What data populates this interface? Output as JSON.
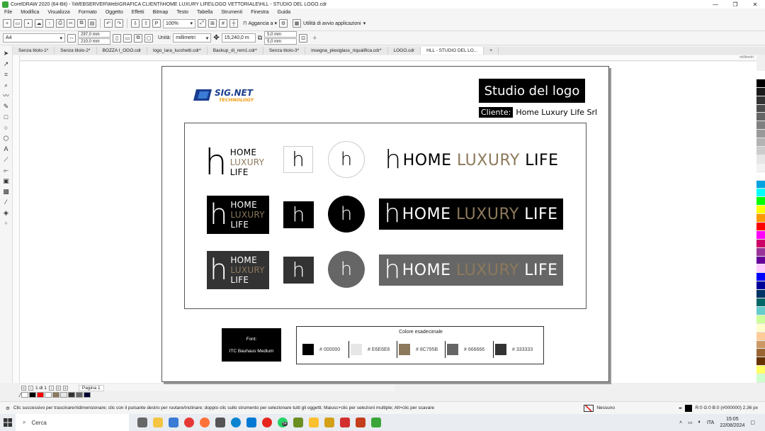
{
  "window": {
    "title": "CorelDRAW 2020 (64-Bit) - \\\\WEBSERVER\\Web\\GRAFICA CLIENTI\\HOME LUXURY LIFE\\LOGO VETTORIALE\\HLL - STUDIO DEL LOGO.cdr"
  },
  "menu": [
    "File",
    "Modifica",
    "Visualizza",
    "Formato",
    "Oggetto",
    "Effetti",
    "Bitmap",
    "Testo",
    "Tabella",
    "Strumenti",
    "Finestra",
    "Guida"
  ],
  "toolbar": {
    "zoom": "100%",
    "snap_label": "Aggancia a",
    "launcher_label": "Utilità di avvio applicazioni"
  },
  "propbar": {
    "page_size": "A4",
    "width": "297,0 mm",
    "height": "210,0 mm",
    "units_label": "Unità:",
    "units": "millimetri",
    "nudge": "15,240,0 m",
    "dup_x": "5,0 mm",
    "dup_y": "5,0 mm"
  },
  "tabs": [
    "Senza titolo-1*",
    "Senza titolo-2*",
    "BOZZA I_OGO.cdr",
    "logo_lara_lucchetti.cdr*",
    "Backup_di_rem1.cdr*",
    "Senza titolo-3*",
    "insegna_plexiglass_riqualifica.cdr*",
    "LOGO.cdr",
    "HLL - STUDIO DEL LO..."
  ],
  "ruler_unit": "millimetri",
  "doc": {
    "sig_logo_text": "SIG.NET",
    "sig_logo_sub": "TECHNOLOGY",
    "studio_title": "Studio del logo",
    "client_label": "Cliente:",
    "client_name": "Home Luxury Life Srl",
    "brand": {
      "mark": "h",
      "word1": "HOME",
      "word2": "LUXURY",
      "word3": "LIFE"
    },
    "font_label": "Font:",
    "font_name": "ITC Bauhaus Medium",
    "colors_title": "Colore esadecimale",
    "colors": [
      {
        "hex": "#000000",
        "label": "# 000000"
      },
      {
        "hex": "#E6E6E6",
        "label": "# E6E6E6"
      },
      {
        "hex": "#8C795B",
        "label": "# 8C795B"
      },
      {
        "hex": "#666666",
        "label": "# 666666"
      },
      {
        "hex": "#333333",
        "label": "# 333333"
      }
    ],
    "gold": "#8C795B"
  },
  "pagenav": {
    "page_counter": "1 di 1",
    "page_tab": "Pagina 1"
  },
  "status": {
    "hint": "Clic successivo per trascinare/ridimensionare; clic con il pulsante destro per ruotare/inclinare; doppio clic sullo strumento per selezionare tutti gli oggetti; Maiusc+clic per selezioni multiple; Alt+clic per scavare",
    "fill": "Nessuno",
    "outline": "R:0 G:0 B:0 (#000000)  2,36 px"
  },
  "taskbar": {
    "search": "Cerca",
    "lang": "ITA",
    "time": "15:05",
    "date": "22/08/2024",
    "whatsapp_badge": "54"
  },
  "palette_colors": [
    "#ffffff",
    "#000000",
    "#1a1a1a",
    "#333333",
    "#4d4d4d",
    "#666666",
    "#808080",
    "#999999",
    "#b3b3b3",
    "#cccccc",
    "#e6e6e6",
    "#f2f2f2",
    "#ffffff",
    "#00a3e0",
    "#00ffff",
    "#00ff00",
    "#ffff00",
    "#ff9900",
    "#ff0000",
    "#ff00ff",
    "#cc0066",
    "#993399",
    "#660099",
    "#ffccff",
    "#0000ff",
    "#000099",
    "#003366",
    "#006666",
    "#66cccc",
    "#ccff99",
    "#ffffcc",
    "#ffcc99",
    "#cc9966",
    "#996633",
    "#663300",
    "#ffff66",
    "#ccffcc"
  ]
}
